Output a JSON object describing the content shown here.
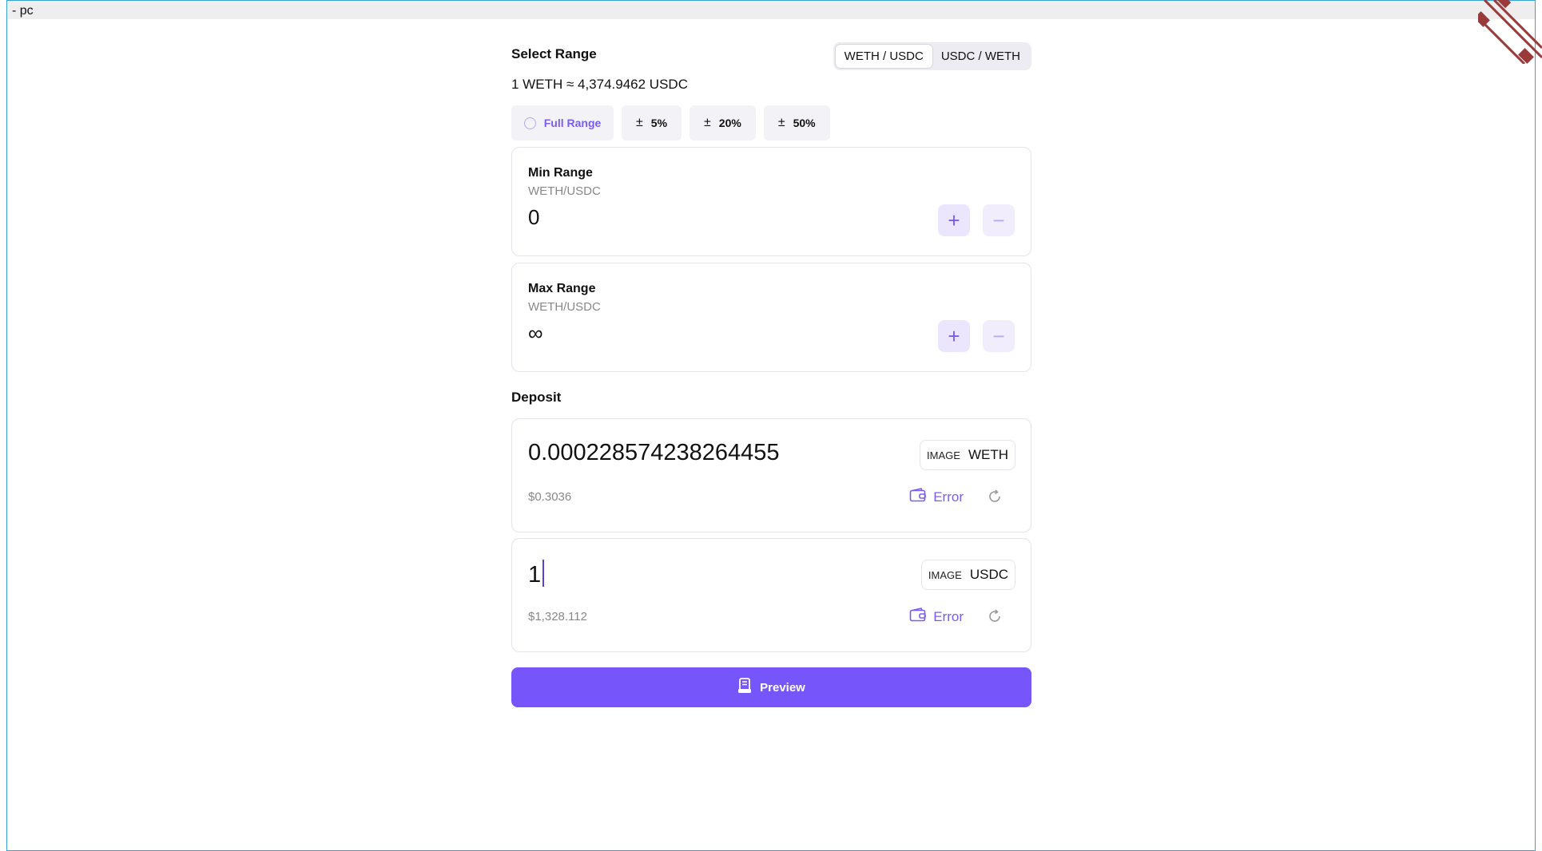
{
  "window": {
    "title": "- pc"
  },
  "range": {
    "title": "Select Range",
    "pair_options": [
      "WETH / USDC",
      "USDC / WETH"
    ],
    "active_pair": "WETH / USDC",
    "rate": "1 WETH ≈ 4,374.9462 USDC",
    "presets": {
      "full": "Full Range",
      "p5": "5%",
      "p20": "20%",
      "p50": "50%",
      "pm_symbol": "±"
    }
  },
  "min_range": {
    "label": "Min Range",
    "pair": "WETH/USDC",
    "value": "0",
    "plus": "+",
    "minus": "−"
  },
  "max_range": {
    "label": "Max Range",
    "pair": "WETH/USDC",
    "value": "∞",
    "plus": "+",
    "minus": "−"
  },
  "deposit": {
    "title": "Deposit",
    "weth": {
      "amount": "0.000228574238264455",
      "usd": "$0.3036",
      "image_label": "IMAGE",
      "symbol": "WETH",
      "balance_label": "Error"
    },
    "usdc": {
      "amount": "1",
      "usd": "$1,328.112",
      "image_label": "IMAGE",
      "symbol": "USDC",
      "balance_label": "Error"
    }
  },
  "actions": {
    "preview_label": "Preview"
  },
  "colors": {
    "accent": "#7655fa",
    "accent_soft": "#ebe5fd",
    "frame": "#3aa0d8",
    "ribbon": "#9b3a3a"
  },
  "icons": [
    "radio-icon",
    "plus-icon",
    "minus-icon",
    "wallet-icon",
    "refresh-icon",
    "preview-icon"
  ]
}
